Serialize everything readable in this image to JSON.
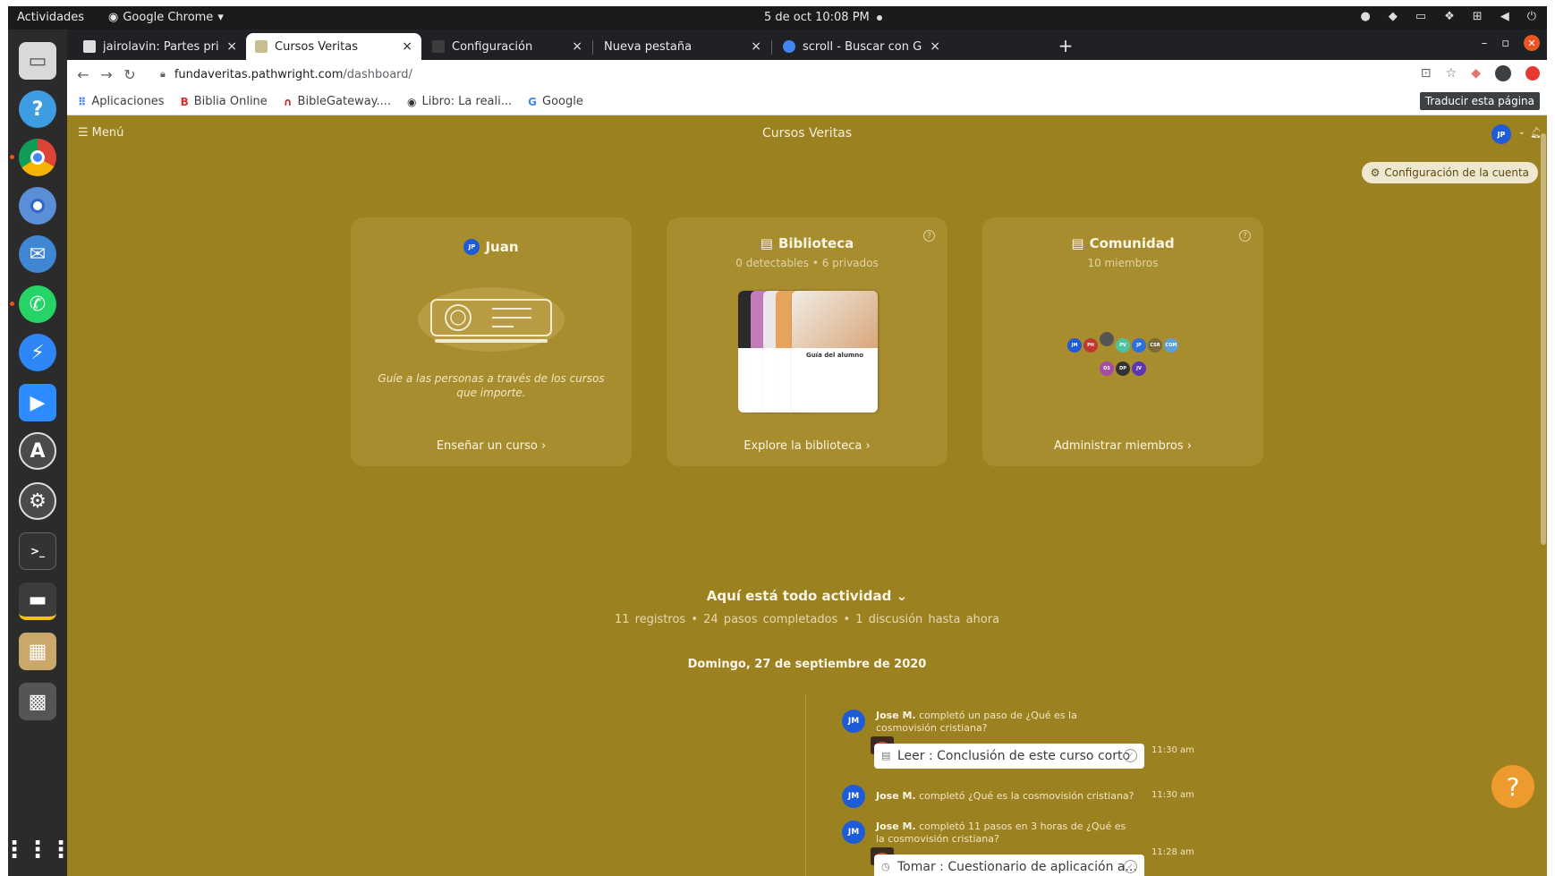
{
  "topbar": {
    "activities": "Actividades",
    "app_name": "Google Chrome",
    "clock": "5 de oct  10:08 PM"
  },
  "tabs": [
    {
      "title": "jairolavin: Partes principa",
      "close": "×"
    },
    {
      "title": "Cursos Veritas",
      "close": "×"
    },
    {
      "title": "Configuración",
      "close": "×"
    },
    {
      "title": "Nueva pestaña",
      "close": "×"
    },
    {
      "title": "scroll - Buscar con Google",
      "close": "×"
    }
  ],
  "newtab_label": "+",
  "url": {
    "host": "fundaveritas.pathwright.com",
    "path": "/dashboard/"
  },
  "bookmarks": [
    {
      "icon": "⠿",
      "label": "Aplicaciones"
    },
    {
      "icon": "B",
      "label": "Biblia Online"
    },
    {
      "icon": "∩",
      "label": "BibleGateway...."
    },
    {
      "icon": "◉",
      "label": "Libro: La reali..."
    },
    {
      "icon": "G",
      "label": "Google"
    }
  ],
  "translate_tooltip": "Traducir esta página",
  "page": {
    "menu_label": "Menú",
    "site_title": "Cursos Veritas",
    "user_initials": "JP",
    "account_settings": "Configuración de la cuenta",
    "cards": {
      "juan": {
        "title": "Juan",
        "avatar": "JP",
        "text": "Guíe a las personas a través de los cursos que importe.",
        "link": "Enseñar un curso ›"
      },
      "biblioteca": {
        "title": "Biblioteca",
        "subtitle": "0 detectables • 6 privados",
        "book_label": "Guía del alumno",
        "link": "Explore la biblioteca ›"
      },
      "comunidad": {
        "title": "Comunidad",
        "subtitle": "10 miembros",
        "link": "Administrar miembros ›",
        "members": [
          "JM",
          "PH",
          "",
          "PV",
          "JP",
          "CSR",
          "COM",
          "DS",
          "DP",
          "JV"
        ]
      }
    },
    "activity": {
      "title": "Aquí está todo actividad",
      "stats": "11 registros • 24 pasos completados • 1 discusión hasta ahora",
      "date": "Domingo, 27 de septiembre de 2020",
      "entries": [
        {
          "initials": "JM",
          "user": "Jose M.",
          "action": " completó un paso de ¿Qué es la cosmovisión cristiana?",
          "time": "11:30 am",
          "step": "Leer : Conclusión de este curso corto"
        },
        {
          "initials": "JM",
          "user": "Jose M.",
          "action": " completó ¿Qué es la cosmovisión cristiana?",
          "time": "11:30 am"
        },
        {
          "initials": "JM",
          "user": "Jose M.",
          "action": " completó 11 pasos en 3 horas de ¿Qué es la cosmovisión cristiana?",
          "time": "11:28 am",
          "step": "Tomar : Cuestionario de aplicación a..."
        }
      ]
    },
    "help_label": "?"
  },
  "colors": {
    "page_bg": "#9c8121",
    "card_bg": "#a88d2e",
    "accent_blue": "#1e5bd6",
    "help_orange": "#ee9b2d"
  }
}
